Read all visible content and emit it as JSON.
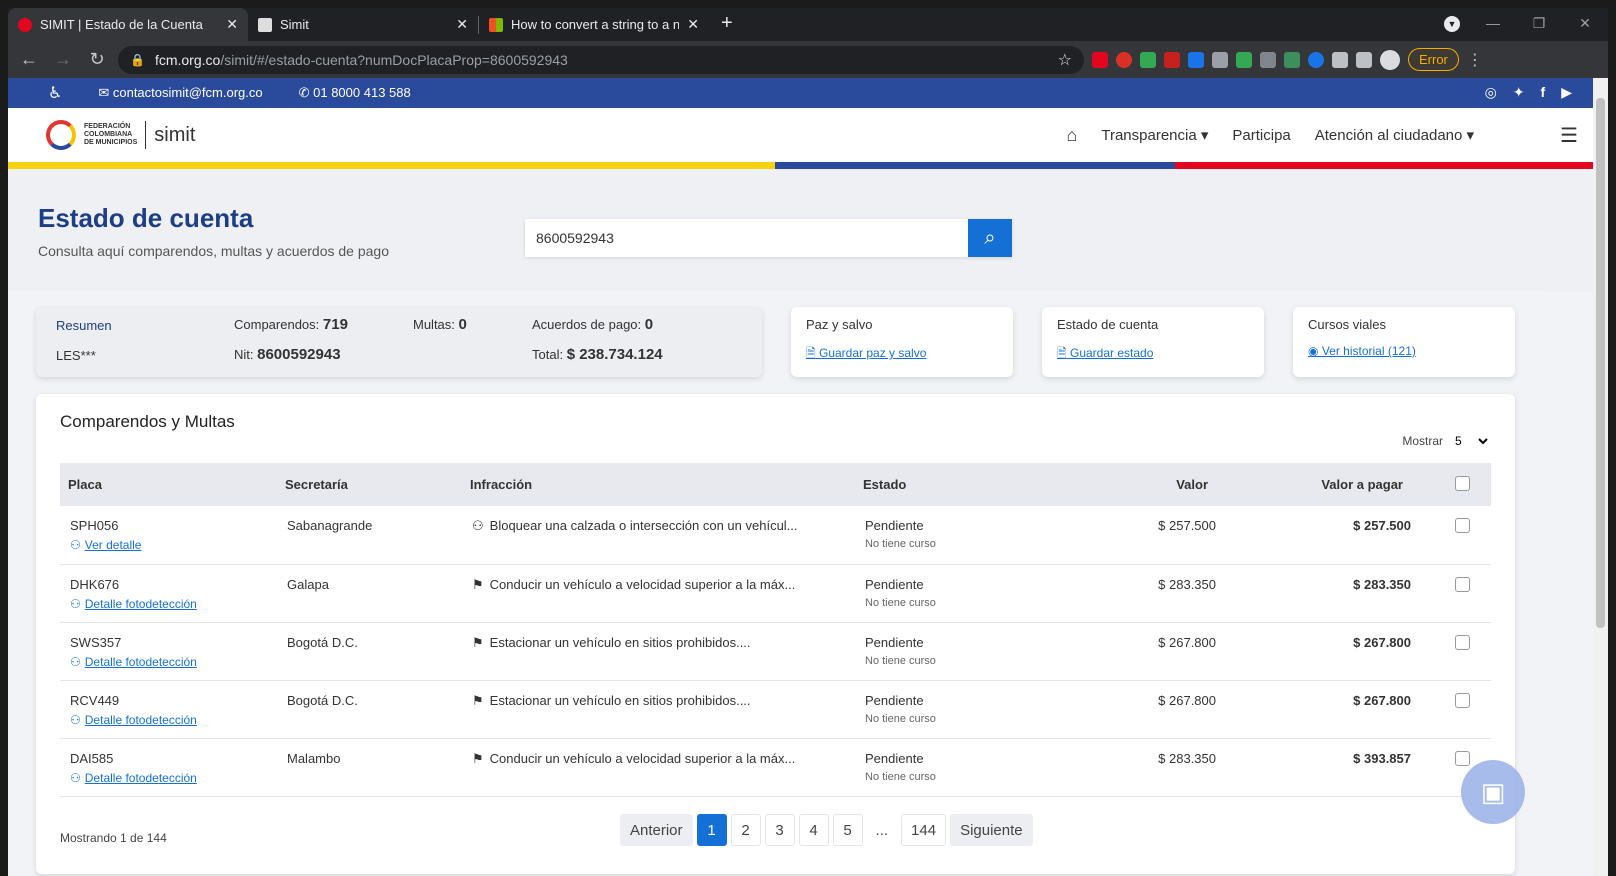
{
  "browser": {
    "tabs": [
      {
        "title": "SIMIT | Estado de la Cuenta",
        "active": true
      },
      {
        "title": "Simit",
        "active": false
      },
      {
        "title": "How to convert a string to a num",
        "active": false
      }
    ],
    "new_tab": "+",
    "url_host": "fcm.org.co",
    "url_path": "/simit/#/estado-cuenta?numDocPlacaProp=8600592943",
    "error_label": "Error"
  },
  "topbar": {
    "email": "contactosimit@fcm.org.co",
    "phone": "01 8000 413 588"
  },
  "header": {
    "logo_text_1": "FEDERACIÓN",
    "logo_text_2": "COLOMBIANA",
    "logo_text_3": "DE MUNICIPIOS",
    "logo_simit": "simit",
    "nav": [
      "Transparencia ▾",
      "Participa",
      "Atención al ciudadano ▾"
    ]
  },
  "hero": {
    "title": "Estado de cuenta",
    "subtitle": "Consulta aquí comparendos, multas y acuerdos de pago",
    "search_value": "8600592943"
  },
  "resumen": {
    "label": "Resumen",
    "owner": "LES***",
    "comparendos_label": "Comparendos:",
    "comparendos": "719",
    "nit_label": "Nit:",
    "nit": "8600592943",
    "multas_label": "Multas:",
    "multas": "0",
    "acuerdos_label": "Acuerdos de pago:",
    "acuerdos": "0",
    "total_label": "Total:",
    "total": "$ 238.734.124"
  },
  "cards": [
    {
      "title": "Paz y salvo",
      "link": "Guardar paz y salvo"
    },
    {
      "title": "Estado de cuenta",
      "link": "Guardar estado"
    },
    {
      "title": "Cursos viales",
      "link": "Ver historial (121)"
    }
  ],
  "table": {
    "title": "Comparendos y Multas",
    "mostrar_label": "Mostrar",
    "mostrar_value": "5",
    "headers": [
      "Placa",
      "Secretaría",
      "Infracción",
      "Estado",
      "Valor",
      "Valor a pagar"
    ],
    "rows": [
      {
        "placa": "SPH056",
        "link": "Ver detalle",
        "secretaria": "Sabanagrande",
        "infraccion": "Bloquear una calzada o intersección con un vehícul...",
        "estado": "Pendiente",
        "curso": "No tiene curso",
        "valor": "$ 257.500",
        "pagar": "$ 257.500"
      },
      {
        "placa": "DHK676",
        "link": "Detalle fotodetección",
        "secretaria": "Galapa",
        "infraccion": "Conducir un vehículo a velocidad superior a la máx...",
        "estado": "Pendiente",
        "curso": "No tiene curso",
        "valor": "$ 283.350",
        "pagar": "$ 283.350"
      },
      {
        "placa": "SWS357",
        "link": "Detalle fotodetección",
        "secretaria": "Bogotá D.C.",
        "infraccion": "Estacionar un vehículo en sitios prohibidos....",
        "estado": "Pendiente",
        "curso": "No tiene curso",
        "valor": "$ 267.800",
        "pagar": "$ 267.800"
      },
      {
        "placa": "RCV449",
        "link": "Detalle fotodetección",
        "secretaria": "Bogotá D.C.",
        "infraccion": "Estacionar un vehículo en sitios prohibidos....",
        "estado": "Pendiente",
        "curso": "No tiene curso",
        "valor": "$ 267.800",
        "pagar": "$ 267.800"
      },
      {
        "placa": "DAI585",
        "link": "Detalle fotodetección",
        "secretaria": "Malambo",
        "infraccion": "Conducir un vehículo a velocidad superior a la máx...",
        "estado": "Pendiente",
        "curso": "No tiene curso",
        "valor": "$ 283.350",
        "pagar": "$ 393.857"
      }
    ],
    "showing": "Mostrando 1 de 144",
    "pager": {
      "prev": "Anterior",
      "pages": [
        "1",
        "2",
        "3",
        "4",
        "5",
        "...",
        "144"
      ],
      "next": "Siguiente"
    }
  },
  "colors": {
    "brand_blue": "#2a4b9b",
    "title_blue": "#1d3e85",
    "accent": "#1570d6"
  }
}
